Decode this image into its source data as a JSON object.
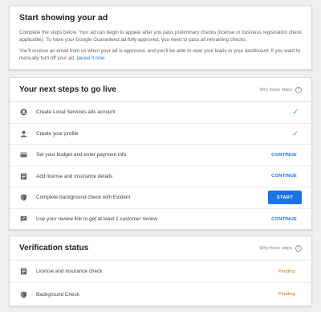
{
  "intro": {
    "title": "Start showing your ad",
    "para1": "Complete the steps below. Your ad can begin to appear after you pass preliminary checks (license or business registration check applicable). To have your Google Guaranteed ad fully approved, you need to pass all remaining checks.",
    "para2_prefix": "You'll receive an email from us when your ad is approved, and you'll be able to view your leads in your dashboard. If you want to manually turn off your ad, ",
    "pause_link": "pause it now",
    "para2_suffix": "."
  },
  "steps": {
    "title": "Your next steps to go live",
    "why_label": "Why these steps",
    "items": [
      {
        "label": "Create Local Services ads account",
        "icon": "account-circle-icon",
        "status": "done"
      },
      {
        "label": "Create your profile",
        "icon": "person-icon",
        "status": "done"
      },
      {
        "label": "Set your budget and enter payment info",
        "icon": "credit-card-icon",
        "action": "CONTINUE"
      },
      {
        "label": "Add license and insurance details",
        "icon": "document-icon",
        "action": "CONTINUE"
      },
      {
        "label": "Complete background check with Evident",
        "icon": "shield-icon",
        "action": "START"
      },
      {
        "label": "Use your review link to get at least 1 customer review",
        "icon": "review-icon",
        "action": "CONTINUE"
      }
    ]
  },
  "verification": {
    "title": "Verification status",
    "why_label": "Why these steps",
    "items": [
      {
        "label": "License and insurance check",
        "icon": "document-icon",
        "status": "Pending"
      },
      {
        "label": "Background Check",
        "icon": "shield-icon",
        "status": "Pending"
      }
    ]
  },
  "colors": {
    "accent": "#1a73e8",
    "success": "#34a853",
    "pending": "#e37400"
  }
}
